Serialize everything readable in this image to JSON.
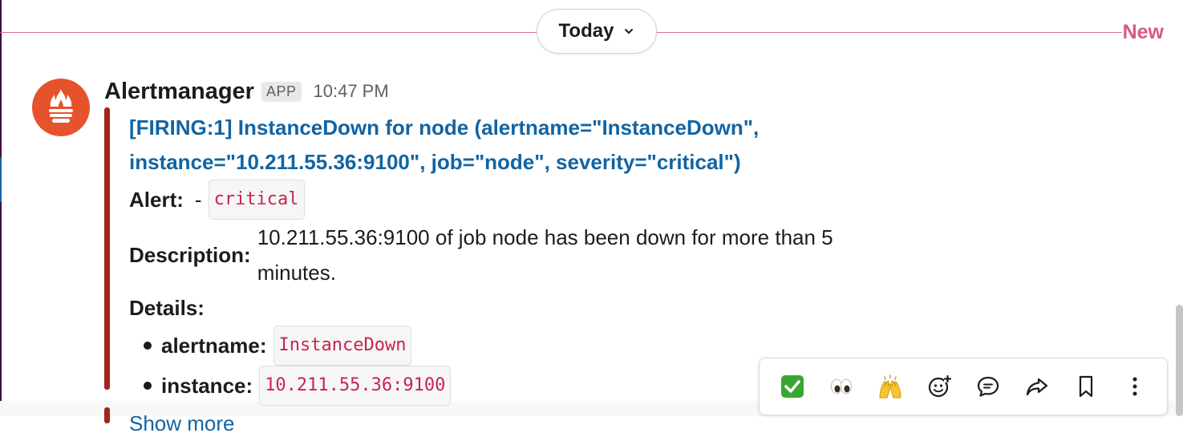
{
  "divider": {
    "date_label": "Today",
    "new_label": "New"
  },
  "message": {
    "sender": "Alertmanager",
    "badge": "APP",
    "time": "10:47 PM",
    "attachment": {
      "title_line1": "[FIRING:1] InstanceDown for node (alertname=\"InstanceDown\",",
      "title_line2": "instance=\"10.211.55.36:9100\", job=\"node\", severity=\"critical\")",
      "alert_label": "Alert:",
      "alert_dash": "-",
      "alert_value": "critical",
      "description_label": "Description:",
      "description_text": "10.211.55.36:9100 of job node has been down for more than 5 minutes.",
      "details_label": "Details:",
      "details": [
        {
          "key": "alertname:",
          "value": "InstanceDown"
        },
        {
          "key": "instance:",
          "value": "10.211.55.36:9100"
        }
      ],
      "show_more": "Show more"
    }
  },
  "toolbar": {
    "reactions": [
      {
        "icon": "check-mark-emoji",
        "glyph": "✅"
      },
      {
        "icon": "eyes-emoji",
        "glyph": "👀"
      },
      {
        "icon": "raised-hands-emoji",
        "glyph": "🙌"
      }
    ],
    "actions": [
      "add-reaction-icon",
      "reply-thread-icon",
      "forward-icon",
      "bookmark-icon",
      "more-actions-icon"
    ]
  },
  "colors": {
    "accent_link": "#1264a3",
    "new_divider": "#d8587f",
    "attachment_bar": "#a1251b",
    "avatar_bg": "#e6522c",
    "code_text": "#c7254e"
  }
}
